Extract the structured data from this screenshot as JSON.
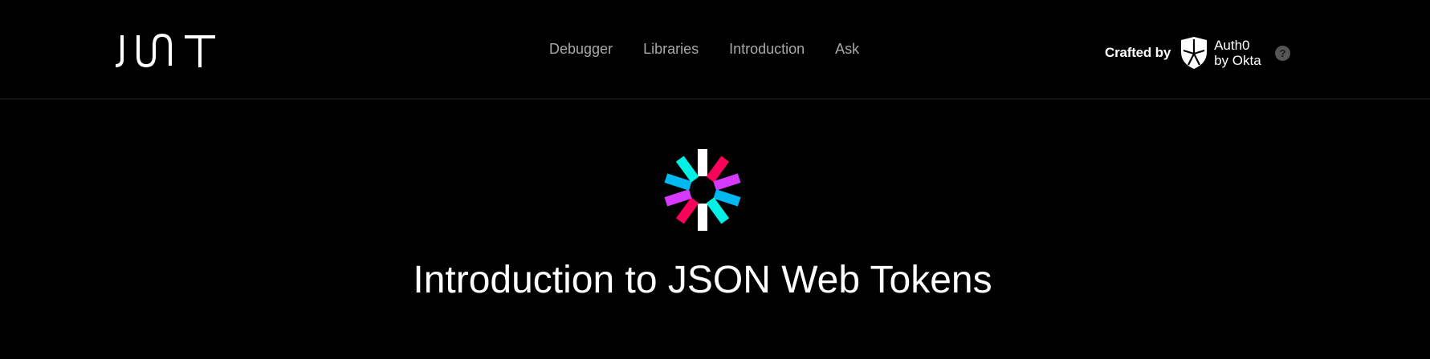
{
  "header": {
    "logo_text": "JWT",
    "nav": [
      {
        "label": "Debugger"
      },
      {
        "label": "Libraries"
      },
      {
        "label": "Introduction"
      },
      {
        "label": "Ask"
      }
    ],
    "crafted_by": "Crafted by",
    "brand_line1": "Auth0",
    "brand_line2": "by Okta",
    "help_glyph": "?"
  },
  "main": {
    "title": "Introduction to JSON Web Tokens"
  },
  "colors": {
    "background": "#000000",
    "nav_text": "#a8a8a8",
    "jwt_white": "#ffffff",
    "jwt_pink": "#fb015b",
    "jwt_purple": "#d63aff",
    "jwt_blue": "#00b9f1",
    "jwt_cyan": "#00f2e6"
  },
  "icons": [
    "jwt-wordmark-icon",
    "auth0-shield-icon",
    "help-icon",
    "jwt-flower-icon"
  ]
}
